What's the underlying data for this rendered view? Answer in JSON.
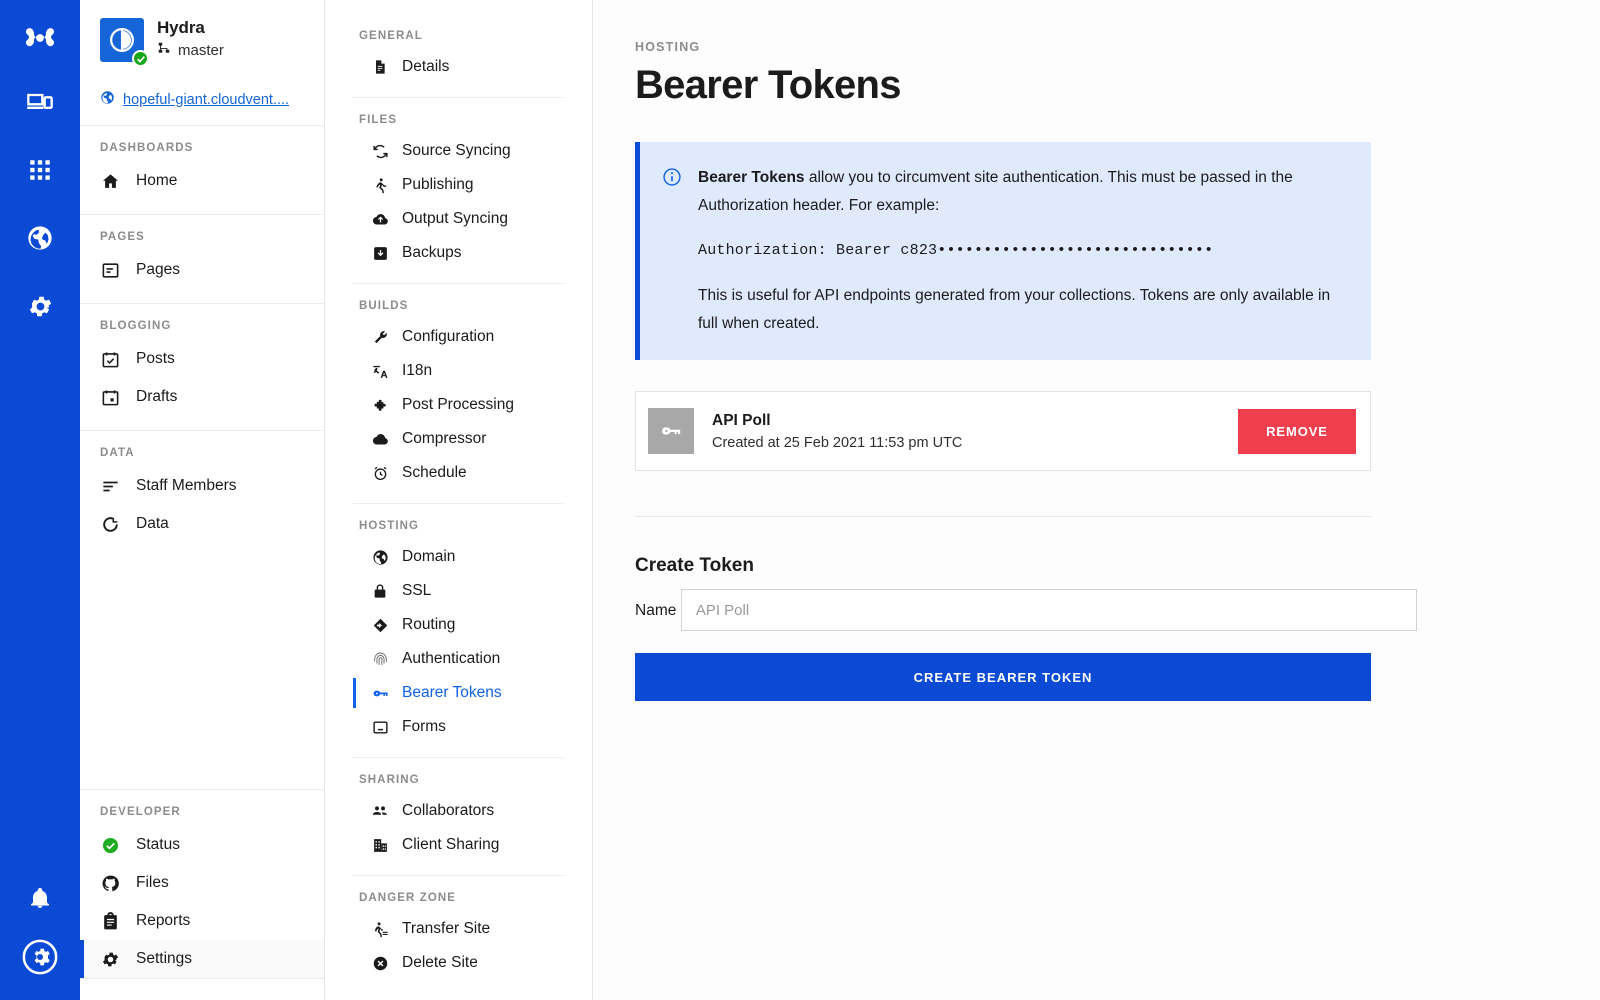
{
  "rail": {
    "items": [
      {
        "icon": "cloudcannon-logo-icon",
        "name": "brand-logo"
      },
      {
        "icon": "devices-icon",
        "name": "rail-item-devices"
      },
      {
        "icon": "apps-grid-icon",
        "name": "rail-item-apps"
      },
      {
        "icon": "globe-icon",
        "name": "rail-item-sites"
      },
      {
        "icon": "gear-icon",
        "name": "rail-item-settings"
      }
    ],
    "bottom": [
      {
        "icon": "bell-icon",
        "name": "rail-item-notifications"
      },
      {
        "icon": "account-avatar-icon",
        "name": "rail-item-account"
      }
    ],
    "background": "#0a4ad4"
  },
  "sidebar": {
    "site": {
      "name": "Hydra",
      "branch": "master",
      "branch_icon": "branch-icon",
      "status_badge": "check-badge",
      "url": "hopeful-giant.cloudvent....",
      "url_icon": "globe-icon"
    },
    "groups": [
      {
        "label": "DASHBOARDS",
        "items": [
          {
            "label": "Home",
            "icon": "home-icon",
            "active": false
          }
        ]
      },
      {
        "label": "PAGES",
        "items": [
          {
            "label": "Pages",
            "icon": "page-icon",
            "active": false
          }
        ]
      },
      {
        "label": "BLOGGING",
        "items": [
          {
            "label": "Posts",
            "icon": "calendar-check-icon",
            "active": false
          },
          {
            "label": "Drafts",
            "icon": "calendar-draft-icon",
            "active": false
          }
        ]
      },
      {
        "label": "DATA",
        "items": [
          {
            "label": "Staff Members",
            "icon": "list-icon",
            "active": false
          },
          {
            "label": "Data",
            "icon": "donut-icon",
            "active": false
          }
        ]
      }
    ],
    "bottom_group": {
      "label": "DEVELOPER",
      "items": [
        {
          "label": "Status",
          "icon": "status-check-icon",
          "active": false
        },
        {
          "label": "Files",
          "icon": "github-icon",
          "active": false
        },
        {
          "label": "Reports",
          "icon": "clipboard-icon",
          "active": false
        },
        {
          "label": "Settings",
          "icon": "gear-icon",
          "active": true
        }
      ]
    }
  },
  "settings_menu": {
    "groups": [
      {
        "label": "GENERAL",
        "items": [
          {
            "label": "Details",
            "icon": "document-icon",
            "active": false
          }
        ]
      },
      {
        "label": "FILES",
        "items": [
          {
            "label": "Source Syncing",
            "icon": "sync-icon",
            "active": false
          },
          {
            "label": "Publishing",
            "icon": "publish-icon",
            "active": false
          },
          {
            "label": "Output Syncing",
            "icon": "cloud-upload-icon",
            "active": false
          },
          {
            "label": "Backups",
            "icon": "backup-icon",
            "active": false
          }
        ]
      },
      {
        "label": "BUILDS",
        "items": [
          {
            "label": "Configuration",
            "icon": "wrench-icon",
            "active": false
          },
          {
            "label": "I18n",
            "icon": "translate-icon",
            "active": false
          },
          {
            "label": "Post Processing",
            "icon": "puzzle-icon",
            "active": false
          },
          {
            "label": "Compressor",
            "icon": "cloud-icon",
            "active": false
          },
          {
            "label": "Schedule",
            "icon": "alarm-clock-icon",
            "active": false
          }
        ]
      },
      {
        "label": "HOSTING",
        "items": [
          {
            "label": "Domain",
            "icon": "globe-icon",
            "active": false
          },
          {
            "label": "SSL",
            "icon": "lock-icon",
            "active": false
          },
          {
            "label": "Routing",
            "icon": "routing-icon",
            "active": false
          },
          {
            "label": "Authentication",
            "icon": "fingerprint-icon",
            "active": false
          },
          {
            "label": "Bearer Tokens",
            "icon": "key-icon",
            "active": true
          },
          {
            "label": "Forms",
            "icon": "inbox-icon",
            "active": false
          }
        ]
      },
      {
        "label": "SHARING",
        "items": [
          {
            "label": "Collaborators",
            "icon": "people-icon",
            "active": false
          },
          {
            "label": "Client Sharing",
            "icon": "building-icon",
            "active": false
          }
        ]
      },
      {
        "label": "DANGER ZONE",
        "items": [
          {
            "label": "Transfer Site",
            "icon": "transfer-icon",
            "active": false
          },
          {
            "label": "Delete Site",
            "icon": "delete-circle-icon",
            "active": false
          }
        ]
      }
    ]
  },
  "main": {
    "eyebrow": "HOSTING",
    "title": "Bearer Tokens",
    "notice": {
      "icon": "info-circle-icon",
      "lead_bold": "Bearer Tokens",
      "lead_rest": " allow you to circumvent site authentication. This must be passed in the Authorization header. For example:",
      "code": "Authorization: Bearer c823••••••••••••••••••••••••••••••",
      "footer": "This is useful for API endpoints generated from your collections. Tokens are only available in full when created.",
      "background": "#dfeaff",
      "accent": "#0a4ad4"
    },
    "tokens": [
      {
        "name": "API Poll",
        "created": "Created at 25 Feb 2021 11:53 pm UTC",
        "icon": "key-icon",
        "remove_label": "REMOVE",
        "remove_color": "#ef3e4d"
      }
    ],
    "create": {
      "title": "Create Token",
      "name_label": "Name",
      "name_value": "",
      "name_placeholder": "API Poll",
      "submit_label": "CREATE BEARER TOKEN",
      "submit_color": "#0a4ad4"
    }
  }
}
